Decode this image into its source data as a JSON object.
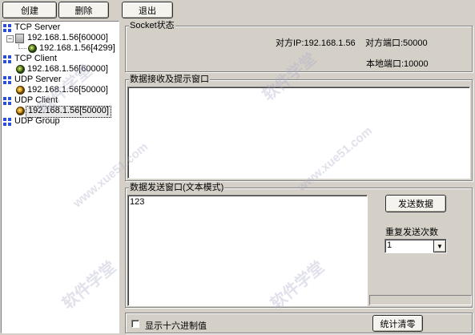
{
  "toolbar": {
    "create": "创建",
    "delete": "删除",
    "exit": "退出"
  },
  "tree": {
    "tcp_server": "TCP Server",
    "tcp_server_host": "192.168.1.56[60000]",
    "tcp_server_conn": "192.168.1.56[4299]",
    "tcp_client": "TCP Client",
    "tcp_client_host": "192.168.1.56[60000]",
    "udp_server": "UDP Server",
    "udp_server_host": "192.168.1.56[50000]",
    "udp_client": "UDP Client",
    "udp_client_host": "192.168.1.56[50000]",
    "udp_group": "UDP Group"
  },
  "socket_status": {
    "title": "Socket状态",
    "remote_ip": "对方IP:192.168.1.56",
    "remote_port": "对方端口:50000",
    "local_port": "本地端口:10000"
  },
  "receive": {
    "title": "数据接收及提示窗口"
  },
  "send": {
    "title": "数据发送窗口(文本模式)",
    "content": "123",
    "send_button": "发送数据",
    "repeat_label": "重复发送次数",
    "repeat_value": "1"
  },
  "bottom": {
    "hex_checkbox": "显示十六进制值",
    "clear_button": "统计清零"
  },
  "watermarks": [
    "软件学堂",
    "www.xue51.com"
  ],
  "colors": {
    "background": "#d4d0c8",
    "selection": "#e8e8e8",
    "tree_icon": "#2a4fd6"
  }
}
